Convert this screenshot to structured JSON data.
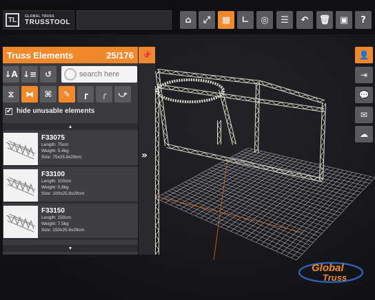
{
  "app": {
    "logo_small": "GLOBAL TRUSS",
    "logo_big": "TRUSSTOOL",
    "logo_mark": "TL"
  },
  "toolbar": {
    "buttons": [
      "home-icon",
      "expand-icon",
      "grid-icon",
      "corner-icon",
      "target-icon",
      "list-icon",
      "undo-icon",
      "trash-icon",
      "screenshot-icon",
      "help-icon"
    ],
    "glyphs": [
      "⌂",
      "⤢",
      "▦",
      "∟",
      "◎",
      "☰",
      "↶",
      "🗑",
      "▣",
      "?"
    ],
    "active_index": 2
  },
  "panel": {
    "title": "Truss Elements",
    "count": "25/176",
    "search_placeholder": "search here",
    "filter_glyphs": [
      "↓A",
      "↓≡",
      "↺"
    ],
    "type_glyphs": [
      "⧖",
      "⧓",
      "⌘",
      "✎",
      "┏",
      "╭",
      "⤻"
    ],
    "type_active_index": 1,
    "type_active_index_2": 3,
    "hide_unusable_label": "hide unusable elements",
    "hide_unusable_checked": true,
    "scroll_up": "▲",
    "scroll_down": "▼",
    "items": [
      {
        "name": "F33075",
        "length": "Length: 75cm",
        "weight": "Weight: 5.4kg",
        "size": "Size: 75x25.8x29cm"
      },
      {
        "name": "F33100",
        "length": "Length: 100cm",
        "weight": "Weight: 5.8kg",
        "size": "Size: 100x25.8x29cm"
      },
      {
        "name": "F33150",
        "length": "Length: 150cm",
        "weight": "Weight: 7.5kg",
        "size": "Size: 150x25.8x29cm"
      }
    ]
  },
  "side": {
    "pin_glyph": "📌",
    "collapse_glyph": "»"
  },
  "rail": {
    "buttons": [
      "user-icon",
      "login-icon",
      "chat-icon",
      "mail-icon",
      "cloud-icon"
    ],
    "glyphs": [
      "👤",
      "⇥",
      "💬",
      "✉",
      "☁"
    ]
  },
  "brand": {
    "line1": "Global",
    "line2": "Truss"
  },
  "colors": {
    "accent": "#f0892c",
    "truss": "#dcdccc",
    "grid": "#aeb0b8"
  }
}
